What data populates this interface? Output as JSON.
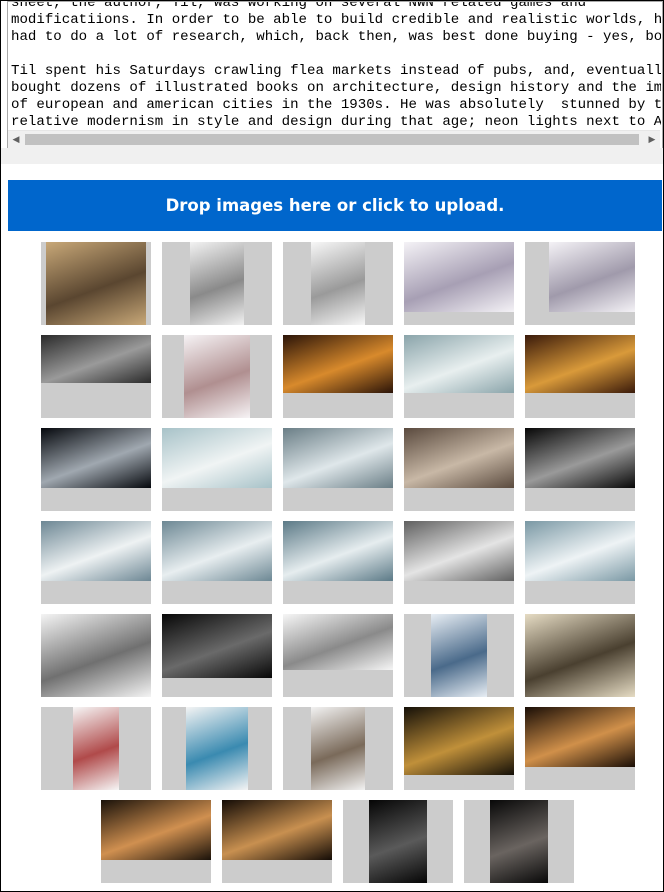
{
  "text_content": {
    "lines": [
      "sheet, the author, Til, was working on several NWN related games and",
      "modificatiions. In order to be able to build credible and realistic worlds, he",
      "had to do a lot of research, which, back then, was best done buying - yes, books!",
      "",
      "Til spent his Saturdays crawling flea markets instead of pubs, and, eventually,",
      "bought dozens of illustrated books on architecture, design history and the images",
      "of european and american cities in the 1930s. He was absolutely  stunned by the",
      "relative modernism in style and design during that age; neon lights next to Art"
    ]
  },
  "scrollbar": {
    "left_icon": "triangle-left-icon",
    "right_icon": "triangle-right-icon"
  },
  "upload": {
    "label": "Drop images here or click to upload."
  },
  "gallery": {
    "rows": [
      [
        {
          "name": "manuscript-page",
          "colors": [
            "#c8a878",
            "#5a4630"
          ]
        },
        {
          "name": "mask-sketch",
          "colors": [
            "#f2f2f2",
            "#8a8a8a"
          ]
        },
        {
          "name": "man-portrait-sketch",
          "colors": [
            "#f7f7f7",
            "#9a9a9a"
          ]
        },
        {
          "name": "woman-portrait-sketch",
          "colors": [
            "#f4f2f6",
            "#a79fb4"
          ]
        },
        {
          "name": "old-man-portrait-sketch",
          "colors": [
            "#f4f2f6",
            "#a09aab"
          ]
        }
      ],
      [
        {
          "name": "streamlined-train",
          "colors": [
            "#2a2a2a",
            "#9a9a9a"
          ]
        },
        {
          "name": "hooded-girl-sketch",
          "colors": [
            "#f6f3f5",
            "#b08f90"
          ]
        },
        {
          "name": "candlelit-room",
          "colors": [
            "#2b1408",
            "#d88a2c"
          ]
        },
        {
          "name": "mountain-aerial",
          "colors": [
            "#8aa4aa",
            "#e8efef"
          ]
        },
        {
          "name": "ornate-hall",
          "colors": [
            "#3a1a0a",
            "#d99a3a"
          ]
        }
      ],
      [
        {
          "name": "city-skyline-night",
          "colors": [
            "#05080d",
            "#a0a8b0"
          ]
        },
        {
          "name": "zeppelin-over-mountains",
          "colors": [
            "#a7c2c8",
            "#f0f4f4"
          ]
        },
        {
          "name": "zeppelin-clouds",
          "colors": [
            "#6a7e86",
            "#dfe7ea"
          ]
        },
        {
          "name": "airship-interior",
          "colors": [
            "#5a4a3e",
            "#c8b8a6"
          ]
        },
        {
          "name": "ship-in-fog",
          "colors": [
            "#070707",
            "#9a9a9a"
          ]
        }
      ],
      [
        {
          "name": "snowy-peaks-1",
          "colors": [
            "#6d8794",
            "#eef2f3"
          ]
        },
        {
          "name": "snowy-peaks-2",
          "colors": [
            "#6d8894",
            "#e8eef0"
          ]
        },
        {
          "name": "snowy-peaks-3",
          "colors": [
            "#5c7a87",
            "#e6edef"
          ]
        },
        {
          "name": "snowy-peaks-4",
          "colors": [
            "#606060",
            "#e4e4e4"
          ]
        },
        {
          "name": "glacier-valley",
          "colors": [
            "#7a98a4",
            "#eef3f5"
          ]
        }
      ],
      [
        {
          "name": "running-men-sketch",
          "colors": [
            "#f4f4f4",
            "#707070"
          ]
        },
        {
          "name": "car-at-night",
          "colors": [
            "#070707",
            "#6a6a6a"
          ]
        },
        {
          "name": "car-design-sketches",
          "colors": [
            "#f6f6f6",
            "#8a8a8a"
          ]
        },
        {
          "name": "magazine-page-1",
          "colors": [
            "#e8eef4",
            "#4a6a8a"
          ]
        },
        {
          "name": "newspaper-page",
          "colors": [
            "#e6dcc4",
            "#4a4030"
          ]
        }
      ],
      [
        {
          "name": "magazine-page-2",
          "colors": [
            "#f6f6f6",
            "#b04a4a"
          ]
        },
        {
          "name": "magazine-page-3",
          "colors": [
            "#f4f4f4",
            "#3a8ab0"
          ]
        },
        {
          "name": "magazine-page-4",
          "colors": [
            "#f2f2f2",
            "#7a6a5a"
          ]
        },
        {
          "name": "old-town-night-1",
          "colors": [
            "#151008",
            "#c0903a"
          ]
        },
        {
          "name": "old-town-night-2",
          "colors": [
            "#1a0e06",
            "#d0904a"
          ]
        }
      ],
      [
        {
          "name": "canal-city-night",
          "colors": [
            "#1a120a",
            "#d09050"
          ]
        },
        {
          "name": "zeitgeist-bridge",
          "colors": [
            "#140c06",
            "#c89050"
          ]
        },
        {
          "name": "zeitgeist-poster-1",
          "colors": [
            "#050505",
            "#5a5a5a"
          ]
        },
        {
          "name": "zeitgeist-poster-2",
          "colors": [
            "#080808",
            "#6a6460"
          ]
        }
      ]
    ]
  }
}
